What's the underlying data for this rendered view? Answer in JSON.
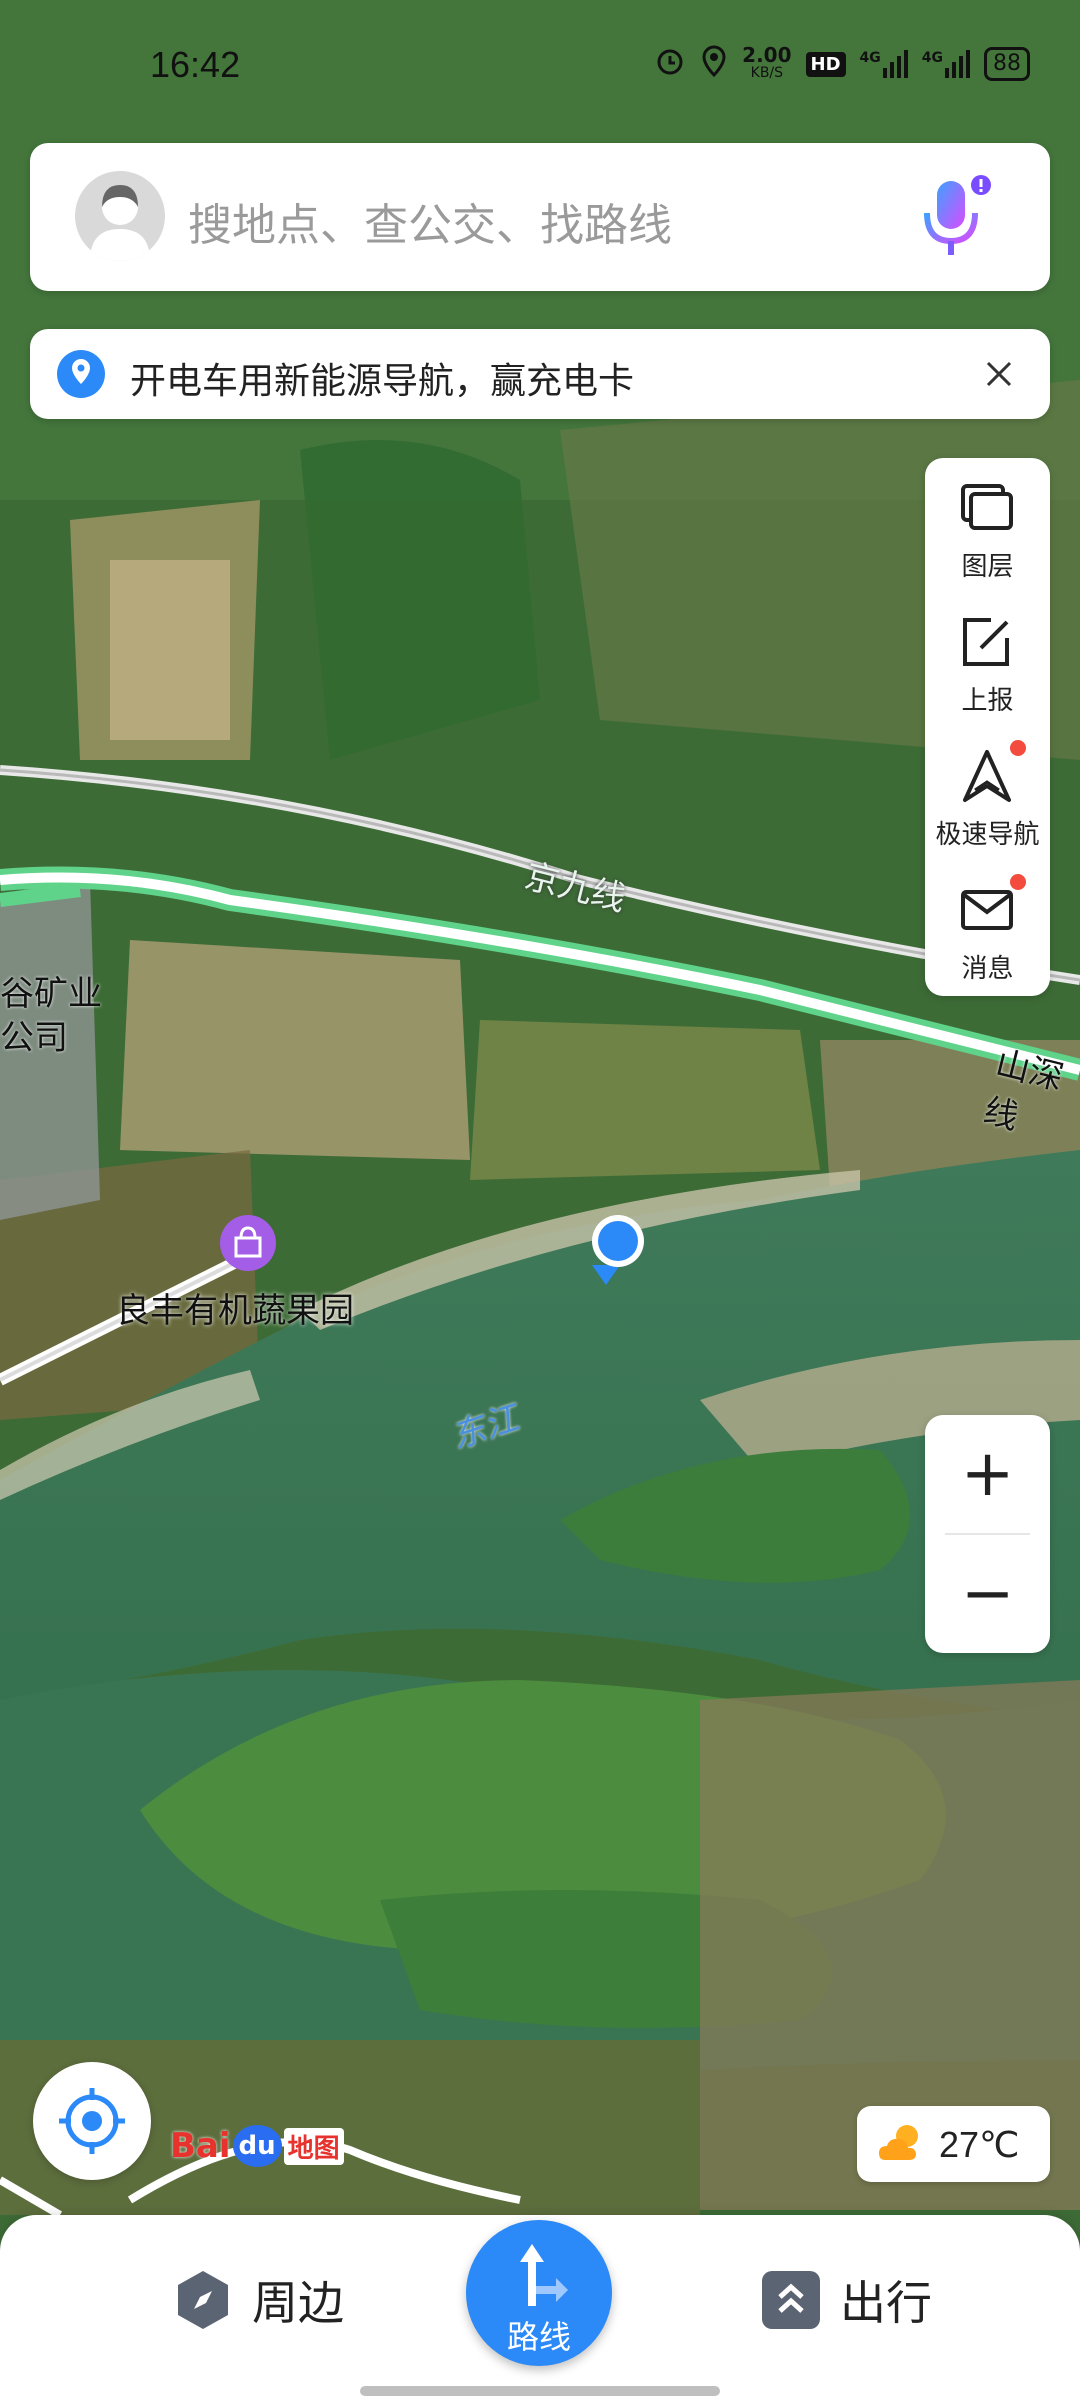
{
  "status_bar": {
    "time": "16:42",
    "net_speed_value": "2.00",
    "net_speed_unit": "KB/S",
    "hd_badge": "HD",
    "sim1": "4G",
    "sim2": "4G",
    "battery": "88"
  },
  "search": {
    "placeholder": "搜地点、查公交、找路线"
  },
  "banner": {
    "text": "开电车用新能源导航，赢充电卡"
  },
  "toolbar": {
    "items": [
      {
        "label": "图层",
        "icon": "layers-icon"
      },
      {
        "label": "上报",
        "icon": "report-edit-icon"
      },
      {
        "label": "极速导航",
        "icon": "navigation-arrow-icon",
        "badge": true
      },
      {
        "label": "消息",
        "icon": "mail-icon",
        "badge": true
      }
    ]
  },
  "map": {
    "labels": {
      "railway": "京九线",
      "road": "山深线",
      "company_line1": "谷矿业",
      "company_line2": "公司",
      "poi": "良丰有机蔬果园",
      "river": "东江"
    }
  },
  "zoom": {
    "in_label": "+",
    "out_label": "−"
  },
  "weather": {
    "temp": "27℃",
    "icon": "cloudy-sun-icon"
  },
  "logo": {
    "text_bai": "Bai",
    "text_du": "du",
    "text_map": "地图"
  },
  "bottom_nav": {
    "nearby": "周边",
    "route": "路线",
    "travel": "出行"
  },
  "colors": {
    "accent": "#2b8af7",
    "route_green": "#5fd38a",
    "badge_red": "#f34b3e"
  }
}
